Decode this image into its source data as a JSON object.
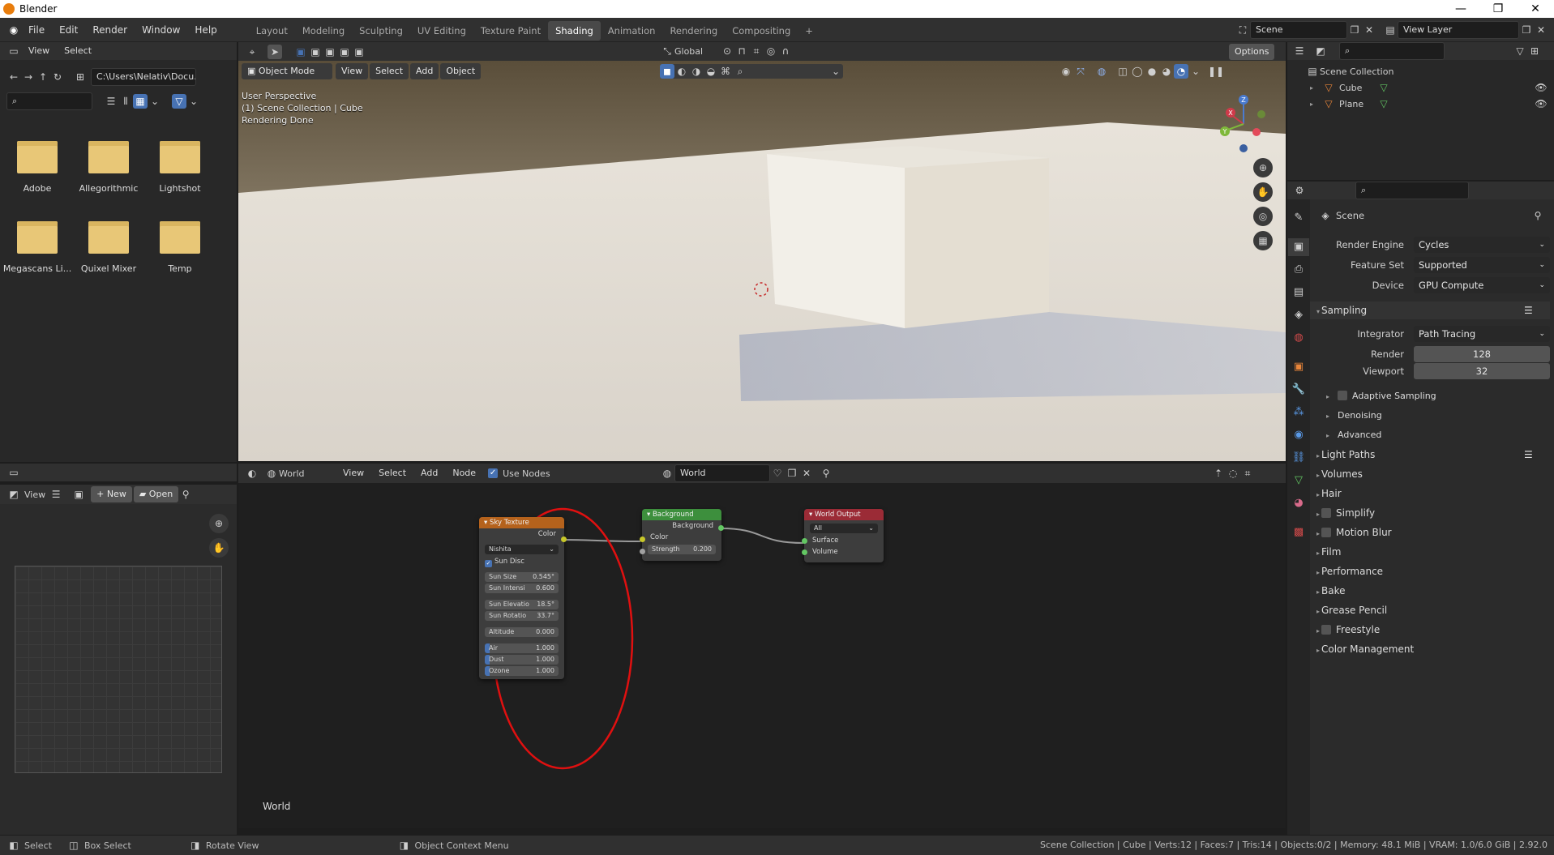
{
  "title": {
    "app": "Blender"
  },
  "topbar": {
    "menus": [
      "File",
      "Edit",
      "Render",
      "Window",
      "Help"
    ],
    "workspaces": [
      "Layout",
      "Modeling",
      "Sculpting",
      "UV Editing",
      "Texture Paint",
      "Shading",
      "Animation",
      "Rendering",
      "Compositing"
    ],
    "active_workspace": "Shading",
    "add_tab": "+",
    "scene": "Scene",
    "view_layer": "View Layer"
  },
  "filebrowser": {
    "menus": [
      "View",
      "Select"
    ],
    "path": "C:\\Users\\Nelativ\\Docu...",
    "folders": [
      "Adobe",
      "Allegorithmic",
      "Lightshot",
      "Megascans Li...",
      "Quixel Mixer",
      "Temp"
    ]
  },
  "image_editor": {
    "view": "View",
    "new": "New",
    "open": "Open"
  },
  "viewport": {
    "mode": "Object Mode",
    "menus": [
      "View",
      "Select",
      "Add",
      "Object"
    ],
    "orientation": "Global",
    "options": "Options",
    "info": [
      "User Perspective",
      "(1) Scene Collection | Cube",
      "Rendering Done"
    ],
    "gizmo": {
      "x": "X",
      "y": "Y",
      "z": "Z"
    }
  },
  "node_editor": {
    "type": "World",
    "menus": [
      "View",
      "Select",
      "Add",
      "Node"
    ],
    "use_nodes": "Use Nodes",
    "datablock": "World",
    "footer_label": "World",
    "sky": {
      "title": "Sky Texture",
      "out": "Color",
      "model": "Nishita",
      "sun_disc": "Sun Disc",
      "fields": [
        {
          "label": "Sun Size",
          "value": "0.545°"
        },
        {
          "label": "Sun Intensi",
          "value": "0.600"
        },
        {
          "label": "Sun Elevatio",
          "value": "18.5°"
        },
        {
          "label": "Sun Rotatio",
          "value": "33.7°"
        },
        {
          "label": "Altitude",
          "value": "0.000"
        },
        {
          "label": "Air",
          "value": "1.000"
        },
        {
          "label": "Dust",
          "value": "1.000"
        },
        {
          "label": "Ozone",
          "value": "1.000"
        }
      ]
    },
    "background": {
      "title": "Background",
      "out": "Background",
      "in_color": "Color",
      "strength_label": "Strength",
      "strength_value": "0.200"
    },
    "world_output": {
      "title": "World Output",
      "target": "All",
      "surface": "Surface",
      "volume": "Volume"
    }
  },
  "outliner": {
    "root": "Scene Collection",
    "items": [
      "Cube",
      "Plane"
    ]
  },
  "properties": {
    "context": "Scene",
    "render_engine": {
      "label": "Render Engine",
      "value": "Cycles"
    },
    "feature_set": {
      "label": "Feature Set",
      "value": "Supported"
    },
    "device": {
      "label": "Device",
      "value": "GPU Compute"
    },
    "sampling": "Sampling",
    "integrator": {
      "label": "Integrator",
      "value": "Path Tracing"
    },
    "render": {
      "label": "Render",
      "value": "128"
    },
    "viewport": {
      "label": "Viewport",
      "value": "32"
    },
    "sub_sections": [
      "Adaptive Sampling",
      "Denoising",
      "Advanced"
    ],
    "sections": [
      "Light Paths",
      "Volumes",
      "Hair",
      "Simplify",
      "Motion Blur",
      "Film",
      "Performance",
      "Bake",
      "Grease Pencil",
      "Freestyle",
      "Color Management"
    ]
  },
  "statusbar": {
    "select": "Select",
    "box_select": "Box Select",
    "rotate": "Rotate View",
    "context_menu": "Object Context Menu",
    "stats": "Scene Collection | Cube | Verts:12 | Faces:7 | Tris:14 | Objects:0/2 | Memory: 48.1 MiB | VRAM: 1.0/6.0 GiB | 2.92.0"
  },
  "colors": {
    "accent": "#4772b3",
    "sky_header": "#b5621c",
    "bg_header": "#3d8f3d",
    "output_header": "#9b2b36",
    "annotation": "#e01010"
  }
}
